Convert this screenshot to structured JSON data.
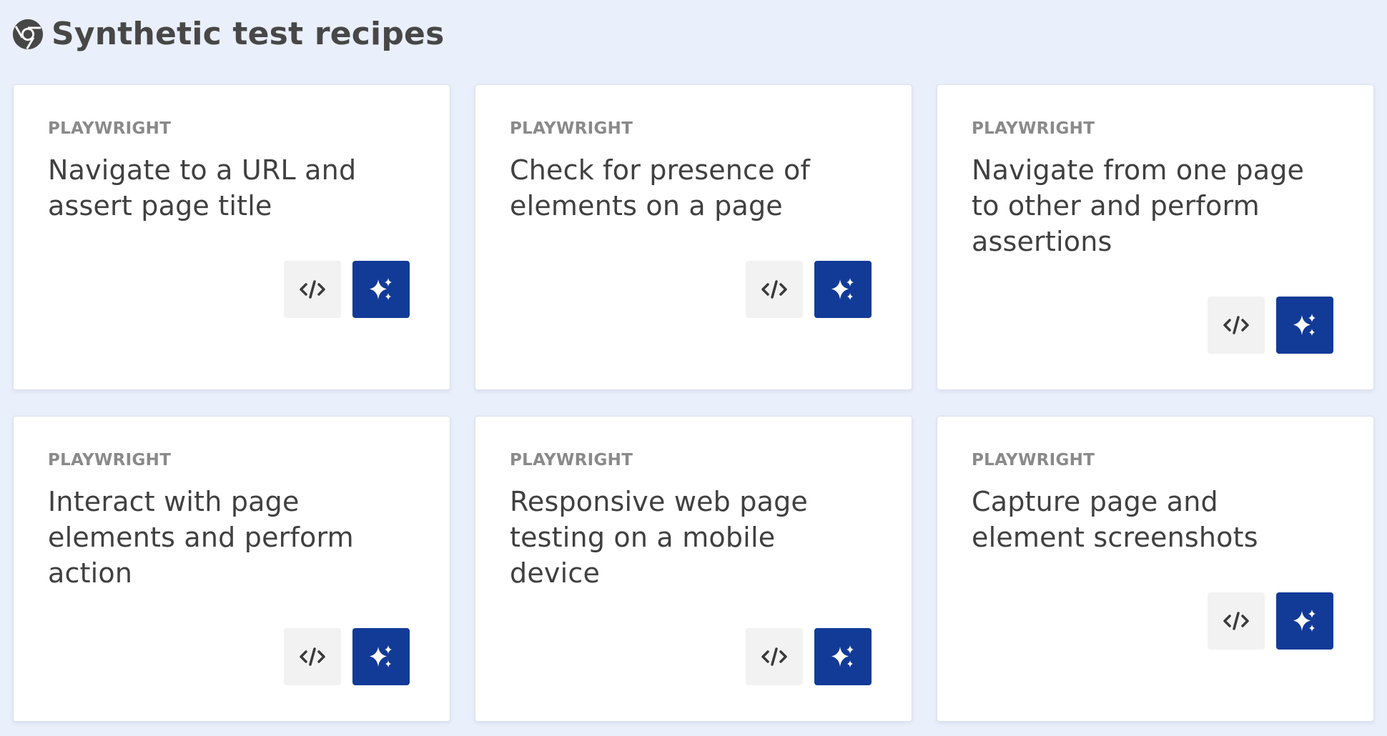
{
  "header": {
    "title": "Synthetic test recipes",
    "icon": "chrome-icon"
  },
  "colors": {
    "page_background": "#e9effb",
    "card_background": "#ffffff",
    "code_button": "#f2f2f2",
    "ai_button": "#123a97"
  },
  "cards": [
    {
      "kicker": "PLAYWRIGHT",
      "title": "Navigate to a URL and assert page title"
    },
    {
      "kicker": "PLAYWRIGHT",
      "title": "Check for presence of elements on a page"
    },
    {
      "kicker": "PLAYWRIGHT",
      "title": "Navigate from one page to other and perform assertions"
    },
    {
      "kicker": "PLAYWRIGHT",
      "title": "Interact with page elements and perform action"
    },
    {
      "kicker": "PLAYWRIGHT",
      "title": "Responsive web page testing on a mobile device"
    },
    {
      "kicker": "PLAYWRIGHT",
      "title": "Capture page and element screenshots"
    }
  ],
  "card_actions": {
    "code_icon": "code-icon",
    "ai_icon": "sparkles-icon"
  }
}
